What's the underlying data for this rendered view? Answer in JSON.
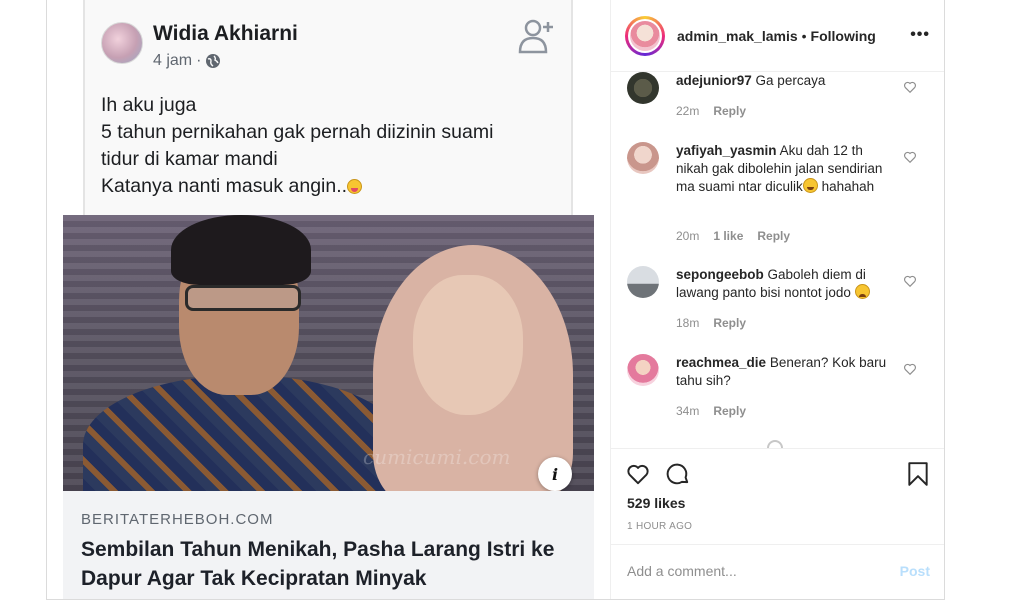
{
  "colors": {
    "accent": "#0095f6",
    "post_disabled": "#b9dffc",
    "muted": "#8e8e8e",
    "text": "#262626"
  },
  "media": {
    "fb_post": {
      "author": "Widia Akhiarni",
      "time": "4 jam",
      "lines": [
        "Ih aku juga",
        "5 tahun pernikahan gak pernah diizinin suami",
        "tidur di kamar mandi",
        "Katanya nanti masuk angin.."
      ]
    },
    "photo_watermark": "cumicumi.com",
    "info_glyph": "i",
    "link": {
      "domain": "BERITATERHEBOH.COM",
      "title": "Sembilan Tahun Menikah, Pasha Larang Istri ke Dapur Agar Tak Kecipratan Minyak"
    }
  },
  "header": {
    "username": "admin_mak_lamis",
    "separator": "•",
    "follow_status": "Following",
    "more_glyph": "•••"
  },
  "comments": [
    {
      "user": "adejunior97",
      "text": "Ga percaya",
      "time": "22m",
      "likes": "",
      "reply": "Reply"
    },
    {
      "user": "yafiyah_yasmin",
      "text": "Aku dah 12 th nikah gak dibolehin jalan sendirian ma suami ntar diculik",
      "suffix": "hahahah",
      "time": "20m",
      "likes": "1 like",
      "reply": "Reply"
    },
    {
      "user": "sepongeebob",
      "text": "Gaboleh diem di lawang panto bisi nontot jodo",
      "time": "18m",
      "likes": "",
      "reply": "Reply"
    },
    {
      "user": "reachmea_die",
      "text": "Beneran? Kok baru tahu sih?",
      "time": "34m",
      "likes": "",
      "reply": "Reply"
    }
  ],
  "actions": {
    "likes": "529 likes",
    "posted": "1 HOUR AGO"
  },
  "comment_form": {
    "placeholder": "Add a comment...",
    "post_label": "Post"
  }
}
